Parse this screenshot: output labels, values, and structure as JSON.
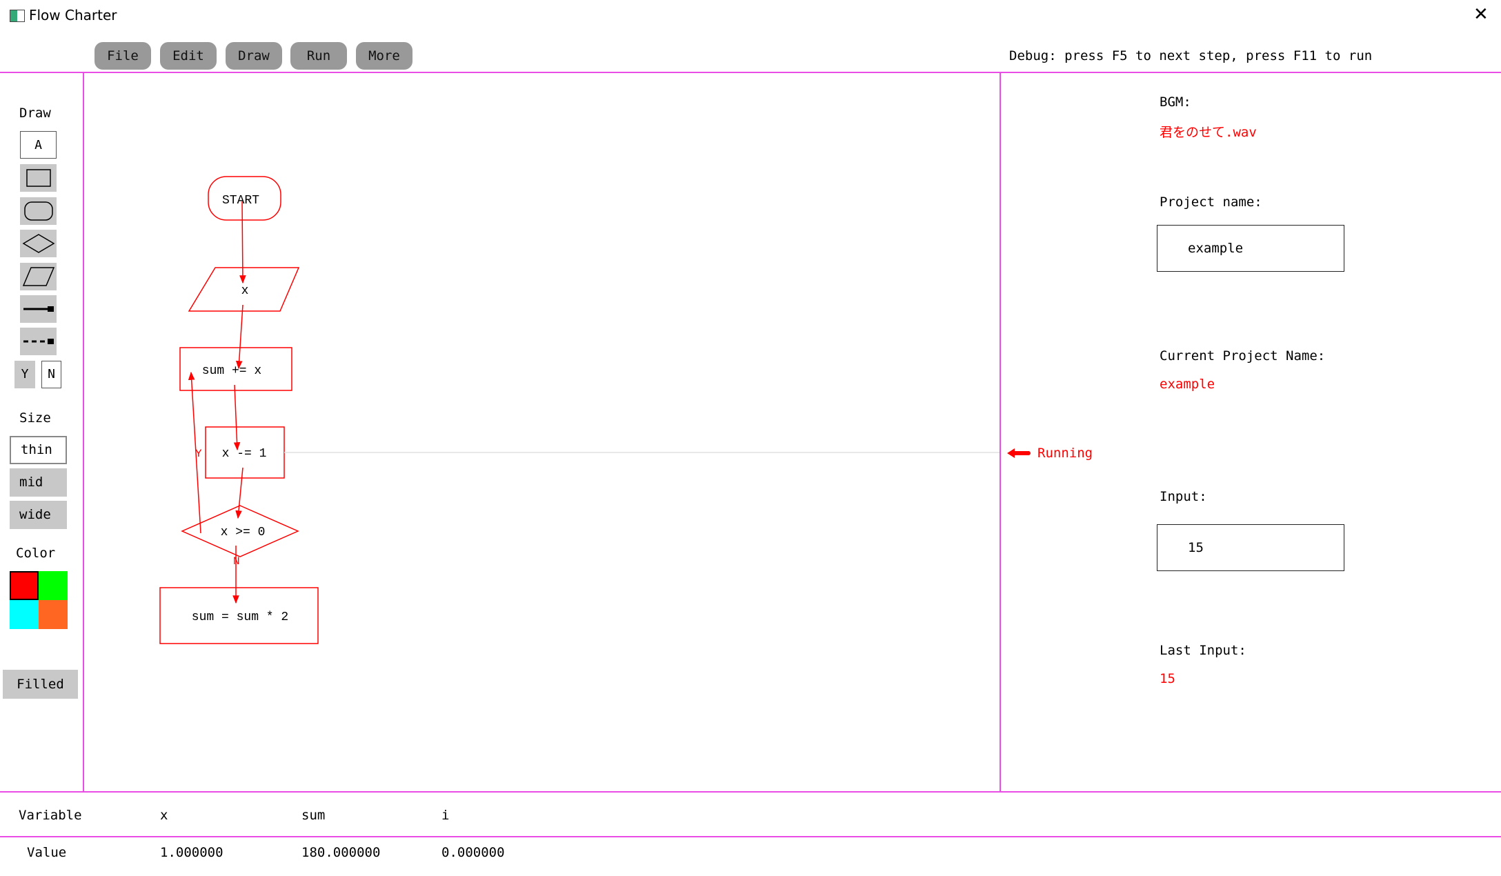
{
  "window": {
    "title": "Flow Charter",
    "close_glyph": "✕"
  },
  "menu": [
    {
      "label": "File"
    },
    {
      "label": "Edit"
    },
    {
      "label": "Draw"
    },
    {
      "label": "Run"
    },
    {
      "label": "More"
    }
  ],
  "debug_hint": "Debug: press F5 to next step, press F11 to run",
  "toolbar": {
    "draw_label": "Draw",
    "text_tool": "A",
    "tools": [
      "rectangle-tool",
      "rounded-rectangle-tool",
      "diamond-tool",
      "parallelogram-tool",
      "solid-arrow-tool",
      "dashed-arrow-tool"
    ],
    "yes_label": "Y",
    "no_label": "N",
    "size_label": "Size",
    "sizes": [
      "thin",
      "mid",
      "wide"
    ],
    "selected_size": "thin",
    "color_label": "Color",
    "colors": [
      "#ff0000",
      "#00ff00",
      "#00ffff",
      "#ff6622"
    ],
    "selected_color": "#ff0000",
    "filled_label": "Filled"
  },
  "flowchart": {
    "accent_color": "#ff0000",
    "start_label": "START",
    "input_label": "x",
    "step1_label": "sum += x",
    "step2_label": "x -= 1",
    "condition_label": "x >= 0",
    "final_label": "sum = sum * 2",
    "yes_branch": "Y",
    "no_branch": "N"
  },
  "status": {
    "text": "Running"
  },
  "right_panel": {
    "bgm_label": "BGM:",
    "bgm_value": "君をのせて.wav",
    "project_name_label": "Project name:",
    "project_name_value": "example",
    "current_project_label": "Current Project Name:",
    "current_project_value": "example",
    "input_label": "Input:",
    "input_value": "15",
    "last_input_label": "Last Input:",
    "last_input_value": "15"
  },
  "variables": {
    "header_label": "Variable",
    "value_label": "Value",
    "names": [
      "x",
      "sum",
      "i"
    ],
    "values": [
      "1.000000",
      "180.000000",
      "0.000000"
    ]
  }
}
